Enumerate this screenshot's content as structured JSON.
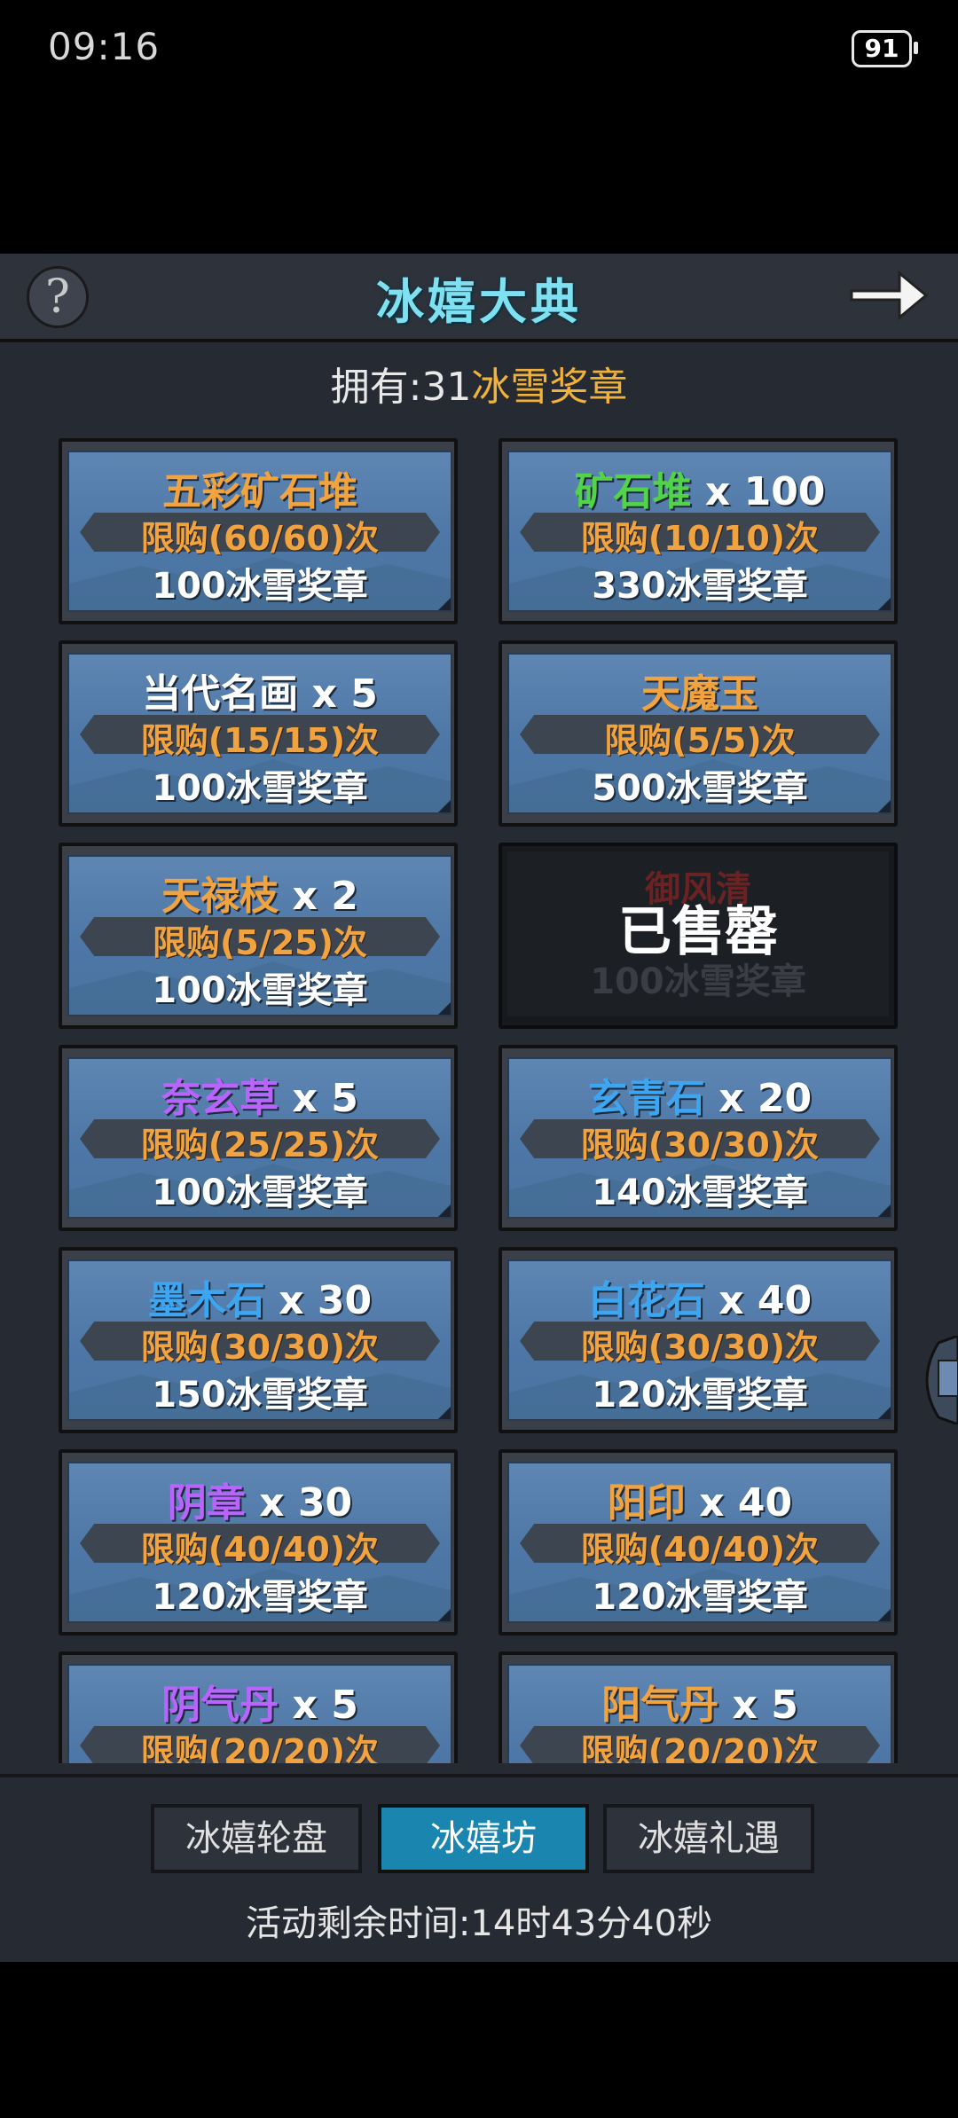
{
  "status": {
    "time": "09:16",
    "battery": "91"
  },
  "header": {
    "help_label": "?",
    "title": "冰嬉大典"
  },
  "owned": {
    "label": "拥有:",
    "count": "31",
    "currency": "冰雪奖章"
  },
  "items": [
    {
      "name": "五彩矿石堆",
      "qty": "",
      "name_color": "orange",
      "limit": "限购(60/60)次",
      "price": "100冰雪奖章",
      "sold_out": false
    },
    {
      "name": "矿石堆",
      "qty": " x 100",
      "name_color": "green",
      "limit": "限购(10/10)次",
      "price": "330冰雪奖章",
      "sold_out": false
    },
    {
      "name": "当代名画",
      "qty": " x 5",
      "name_color": "white",
      "limit": "限购(15/15)次",
      "price": "100冰雪奖章",
      "sold_out": false
    },
    {
      "name": "天魔玉",
      "qty": "",
      "name_color": "orange",
      "limit": "限购(5/5)次",
      "price": "500冰雪奖章",
      "sold_out": false
    },
    {
      "name": "天禄枝",
      "qty": " x 2",
      "name_color": "orange",
      "limit": "限购(5/25)次",
      "price": "100冰雪奖章",
      "sold_out": false
    },
    {
      "name": "御风清",
      "qty": "",
      "name_color": "red",
      "limit": "",
      "price": "100冰雪奖章",
      "sold_out": true,
      "sold_label": "已售罄"
    },
    {
      "name": "奈玄草",
      "qty": " x 5",
      "name_color": "purple",
      "limit": "限购(25/25)次",
      "price": "100冰雪奖章",
      "sold_out": false
    },
    {
      "name": "玄青石",
      "qty": " x 20",
      "name_color": "blue",
      "limit": "限购(30/30)次",
      "price": "140冰雪奖章",
      "sold_out": false
    },
    {
      "name": "墨木石",
      "qty": " x 30",
      "name_color": "blue",
      "limit": "限购(30/30)次",
      "price": "150冰雪奖章",
      "sold_out": false
    },
    {
      "name": "白花石",
      "qty": " x 40",
      "name_color": "blue",
      "limit": "限购(30/30)次",
      "price": "120冰雪奖章",
      "sold_out": false
    },
    {
      "name": "阴章",
      "qty": " x 30",
      "name_color": "purple",
      "limit": "限购(40/40)次",
      "price": "120冰雪奖章",
      "sold_out": false
    },
    {
      "name": "阳印",
      "qty": " x 40",
      "name_color": "orange",
      "limit": "限购(40/40)次",
      "price": "120冰雪奖章",
      "sold_out": false
    },
    {
      "name": "阴气丹",
      "qty": " x 5",
      "name_color": "purple",
      "limit": "限购(20/20)次",
      "price": "",
      "sold_out": false
    },
    {
      "name": "阳气丹",
      "qty": " x 5",
      "name_color": "orange",
      "limit": "限购(20/20)次",
      "price": "",
      "sold_out": false
    }
  ],
  "tabs": [
    {
      "label": "冰嬉轮盘",
      "active": false
    },
    {
      "label": "冰嬉坊",
      "active": true
    },
    {
      "label": "冰嬉礼遇",
      "active": false
    }
  ],
  "footer": {
    "timer": "活动剩余时间:14时43分40秒"
  },
  "colors": {
    "accent": "#1a86b0",
    "title": "#7fe0f2",
    "currency": "#f0b23a",
    "limit": "#f0a33e"
  }
}
